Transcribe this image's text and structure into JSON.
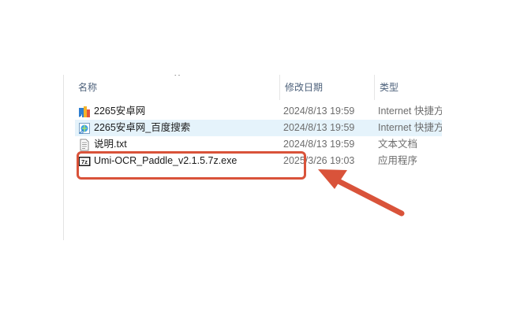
{
  "columns": {
    "name": "名称",
    "date": "修改日期",
    "type": "类型",
    "sort_indicator": "^"
  },
  "files": [
    {
      "name": "2265安卓网",
      "date": "2024/8/13 19:59",
      "type": "Internet 快捷方",
      "icon": "internet-shortcut-icon"
    },
    {
      "name": "2265安卓网_百度搜索",
      "date": "2024/8/13 19:59",
      "type": "Internet 快捷方",
      "icon": "internet-shortcut-icon"
    },
    {
      "name": "说明.txt",
      "date": "2024/8/13 19:59",
      "type": "文本文档",
      "icon": "text-file-icon"
    },
    {
      "name": "Umi-OCR_Paddle_v2.1.5.7z.exe",
      "date": "2025/3/26 19:03",
      "type": "应用程序",
      "icon": "7z-exe-icon"
    }
  ],
  "selected_index": 1,
  "annotation": {
    "color": "#d9533a",
    "highlighted_file_index": 3
  }
}
